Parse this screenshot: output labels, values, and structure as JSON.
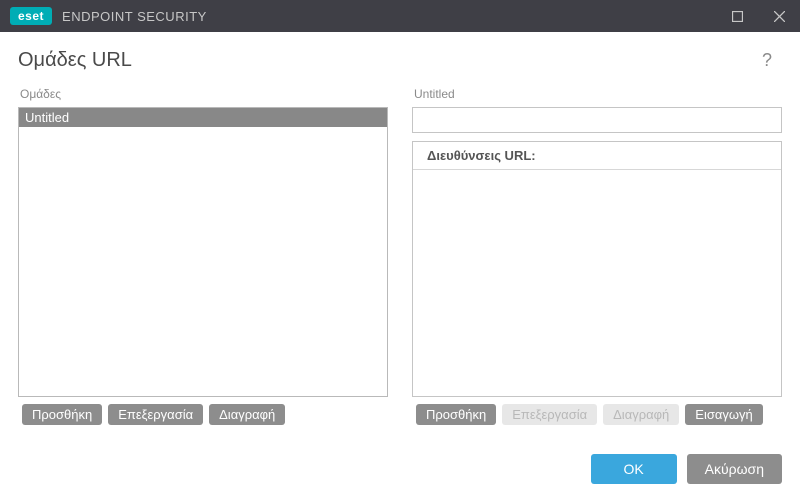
{
  "titlebar": {
    "brand": "eset",
    "product": "ENDPOINT SECURITY"
  },
  "header": {
    "title": "Ομάδες URL"
  },
  "left": {
    "label": "Ομάδες",
    "items": [
      "Untitled"
    ],
    "buttons": {
      "add": "Προσθήκη",
      "edit": "Επεξεργασία",
      "delete": "Διαγραφή"
    }
  },
  "right": {
    "label": "Untitled",
    "url_input_value": "",
    "urls_header": "Διευθύνσεις URL:",
    "buttons": {
      "add": "Προσθήκη",
      "edit": "Επεξεργασία",
      "delete": "Διαγραφή",
      "import": "Εισαγωγή"
    }
  },
  "footer": {
    "ok": "OK",
    "cancel": "Ακύρωση"
  }
}
